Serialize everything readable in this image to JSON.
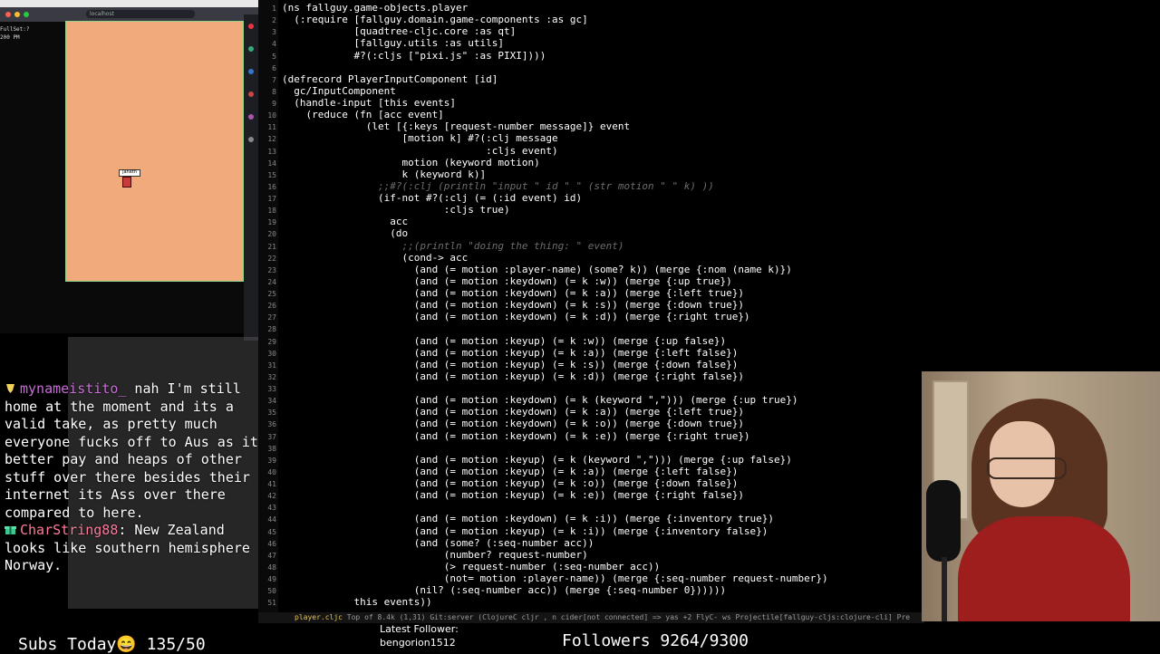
{
  "browser": {
    "url": "localhost",
    "hud_lines": [
      "FullSet:?",
      "200 PM"
    ],
    "player_tag": "janeth"
  },
  "chat": {
    "messages": [
      {
        "user": "mynameistito_",
        "text": " nah I'm still home at the moment and its a valid take, as pretty much everyone fucks off to Aus as its better pay and heaps of other stuff over there besides their internet its Ass over there compared to here."
      },
      {
        "user": "CharString88",
        "text": ": New Zealand looks like southern hemisphere Norway."
      }
    ],
    "subs_label": "Subs Today",
    "subs_value": "135/50"
  },
  "editor": {
    "lines": [
      {
        "n": "1",
        "t": "(ns fallguy.game-objects.player"
      },
      {
        "n": "2",
        "t": "  (:require [fallguy.domain.game-components :as gc]"
      },
      {
        "n": "3",
        "t": "            [quadtree-cljc.core :as qt]"
      },
      {
        "n": "4",
        "t": "            [fallguy.utils :as utils]"
      },
      {
        "n": "5",
        "t": "            #?(:cljs [\"pixi.js\" :as PIXI])))"
      },
      {
        "n": "6",
        "t": ""
      },
      {
        "n": "7",
        "t": "(defrecord PlayerInputComponent [id]"
      },
      {
        "n": "8",
        "t": "  gc/InputComponent"
      },
      {
        "n": "9",
        "t": "  (handle-input [this events]"
      },
      {
        "n": "10",
        "t": "    (reduce (fn [acc event]"
      },
      {
        "n": "11",
        "t": "              (let [{:keys [request-number message]} event"
      },
      {
        "n": "12",
        "t": "                    [motion k] #?(:clj message"
      },
      {
        "n": "13",
        "t": "                                  :cljs event)"
      },
      {
        "n": "14",
        "t": "                    motion (keyword motion)"
      },
      {
        "n": "15",
        "t": "                    k (keyword k)]"
      },
      {
        "n": "16",
        "t": "                ;;#?(:clj (println \"input \" id \" \" (str motion \" \" k) ))",
        "c": true
      },
      {
        "n": "17",
        "t": "                (if-not #?(:clj (= (:id event) id)"
      },
      {
        "n": "18",
        "t": "                           :cljs true)"
      },
      {
        "n": "19",
        "t": "                  acc"
      },
      {
        "n": "20",
        "t": "                  (do"
      },
      {
        "n": "21",
        "t": "                    ;;(println \"doing the thing: \" event)",
        "c": true
      },
      {
        "n": "22",
        "t": "                    (cond-> acc"
      },
      {
        "n": "23",
        "t": "                      (and (= motion :player-name) (some? k)) (merge {:nom (name k)})"
      },
      {
        "n": "24",
        "t": "                      (and (= motion :keydown) (= k :w)) (merge {:up true})"
      },
      {
        "n": "25",
        "t": "                      (and (= motion :keydown) (= k :a)) (merge {:left true})"
      },
      {
        "n": "26",
        "t": "                      (and (= motion :keydown) (= k :s)) (merge {:down true})"
      },
      {
        "n": "27",
        "t": "                      (and (= motion :keydown) (= k :d)) (merge {:right true})"
      },
      {
        "n": "28",
        "t": ""
      },
      {
        "n": "29",
        "t": "                      (and (= motion :keyup) (= k :w)) (merge {:up false})"
      },
      {
        "n": "30",
        "t": "                      (and (= motion :keyup) (= k :a)) (merge {:left false})"
      },
      {
        "n": "31",
        "t": "                      (and (= motion :keyup) (= k :s)) (merge {:down false})"
      },
      {
        "n": "32",
        "t": "                      (and (= motion :keyup) (= k :d)) (merge {:right false})"
      },
      {
        "n": "33",
        "t": ""
      },
      {
        "n": "34",
        "t": "                      (and (= motion :keydown) (= k (keyword \",\"))) (merge {:up true})"
      },
      {
        "n": "35",
        "t": "                      (and (= motion :keydown) (= k :a)) (merge {:left true})"
      },
      {
        "n": "36",
        "t": "                      (and (= motion :keydown) (= k :o)) (merge {:down true})"
      },
      {
        "n": "37",
        "t": "                      (and (= motion :keydown) (= k :e)) (merge {:right true})"
      },
      {
        "n": "38",
        "t": ""
      },
      {
        "n": "39",
        "t": "                      (and (= motion :keyup) (= k (keyword \",\"))) (merge {:up false})"
      },
      {
        "n": "40",
        "t": "                      (and (= motion :keyup) (= k :a)) (merge {:left false})"
      },
      {
        "n": "41",
        "t": "                      (and (= motion :keyup) (= k :o)) (merge {:down false})"
      },
      {
        "n": "42",
        "t": "                      (and (= motion :keyup) (= k :e)) (merge {:right false})"
      },
      {
        "n": "43",
        "t": ""
      },
      {
        "n": "44",
        "t": "                      (and (= motion :keydown) (= k :i)) (merge {:inventory true})"
      },
      {
        "n": "45",
        "t": "                      (and (= motion :keyup) (= k :i)) (merge {:inventory false})"
      },
      {
        "n": "46",
        "t": "                      (and (some? (:seq-number acc))"
      },
      {
        "n": "47",
        "t": "                           (number? request-number)"
      },
      {
        "n": "48",
        "t": "                           (> request-number (:seq-number acc))"
      },
      {
        "n": "49",
        "t": "                           (not= motion :player-name)) (merge {:seq-number request-number})"
      },
      {
        "n": "50",
        "t": "                      (nil? (:seq-number acc)) (merge {:seq-number 0})))))"
      },
      {
        "n": "51",
        "t": "            this events))"
      }
    ],
    "status_file": "player.cljc",
    "status_rest": "   Top  of 8.4k (1,31)     Git:server  (ClojureC cljr , n cider[not connected] => yas +2 FlyC- ws Projectile[fallguy-cljs:clojure-cli] Pre"
  },
  "overlay": {
    "follower_label": "Latest Follower:",
    "follower_name": "bengorion1512",
    "followers_label": "Followers",
    "followers_value": "9264/9300"
  },
  "colors": {
    "canvas": "#f0aa7c",
    "username1": "#c96dd8",
    "username2": "#ff7a9a",
    "statusfile": "#e0c25a"
  }
}
